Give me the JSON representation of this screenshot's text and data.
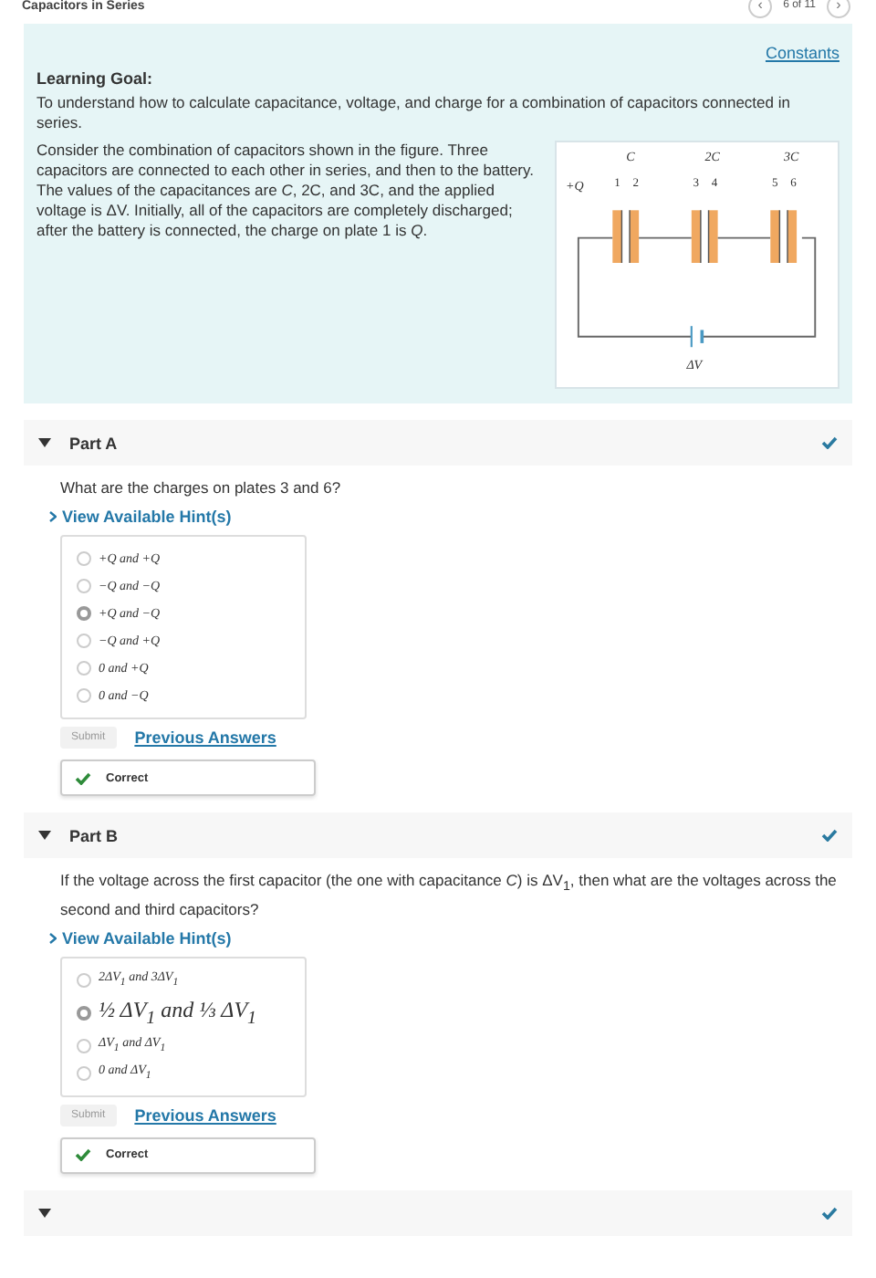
{
  "header": {
    "title": "Capacitors in Series",
    "pager": "6 of 11",
    "prev_icon": "‹",
    "next_icon": "›"
  },
  "intro": {
    "constants_link": "Constants",
    "goal_title": "Learning Goal:",
    "goal_text": "To understand how to calculate capacitance, voltage, and charge for a combination of capacitors connected in series.",
    "description": "Consider the combination of capacitors shown in the figure. Three capacitors are connected to each other in series, and then to the battery. The values of the capacitances are *C*, 2C, and 3C, and the applied voltage is ΔV. Initially, all of the capacitors are completely discharged; after the battery is connected, the charge on plate 1 is *Q*.",
    "figure": {
      "capacitor_labels": [
        "C",
        "2C",
        "3C"
      ],
      "plate_labels": [
        [
          "1",
          "2"
        ],
        [
          "3",
          "4"
        ],
        [
          "5",
          "6"
        ]
      ],
      "charge_label": "+Q",
      "battery_label": "ΔV"
    }
  },
  "parts": [
    {
      "title": "Part A",
      "expanded": true,
      "completed": true,
      "question": "What are the charges on plates 3 and 6?",
      "hint_link": "View Available Hint(s)",
      "options": [
        {
          "label": "+*Q* and +*Q*",
          "selected": false
        },
        {
          "label": "−*Q* and −*Q*",
          "selected": false
        },
        {
          "label": "+*Q* and −*Q*",
          "selected": true
        },
        {
          "label": "−*Q* and +*Q*",
          "selected": false
        },
        {
          "label": "0 and +*Q*",
          "selected": false
        },
        {
          "label": "0 and −*Q*",
          "selected": false
        }
      ],
      "submit": {
        "label": "Submit",
        "disabled": true
      },
      "previous_link": "Previous Answers",
      "feedback": "Correct"
    },
    {
      "title": "Part B",
      "expanded": true,
      "completed": true,
      "question": "If the voltage across the first capacitor (the one with capacitance *C*) is ΔV$_{1}$, then what are the voltages across the second and third capacitors?",
      "hint_link": "View Available Hint(s)",
      "options": [
        {
          "label": "2ΔV$_{1}$ and 3ΔV$_{1}$",
          "selected": false
        },
        {
          "label": "½ ΔV$_{1}$ and ⅓ ΔV$_{1}$",
          "selected": true
        },
        {
          "label": "ΔV$_{1}$ and ΔV$_{1}$",
          "selected": false
        },
        {
          "label": "0 and ΔV$_{1}$",
          "selected": false
        }
      ],
      "submit": {
        "label": "Submit",
        "disabled": true
      },
      "previous_link": "Previous Answers",
      "feedback": "Correct"
    },
    {
      "expanded": true,
      "completed": true
    }
  ]
}
